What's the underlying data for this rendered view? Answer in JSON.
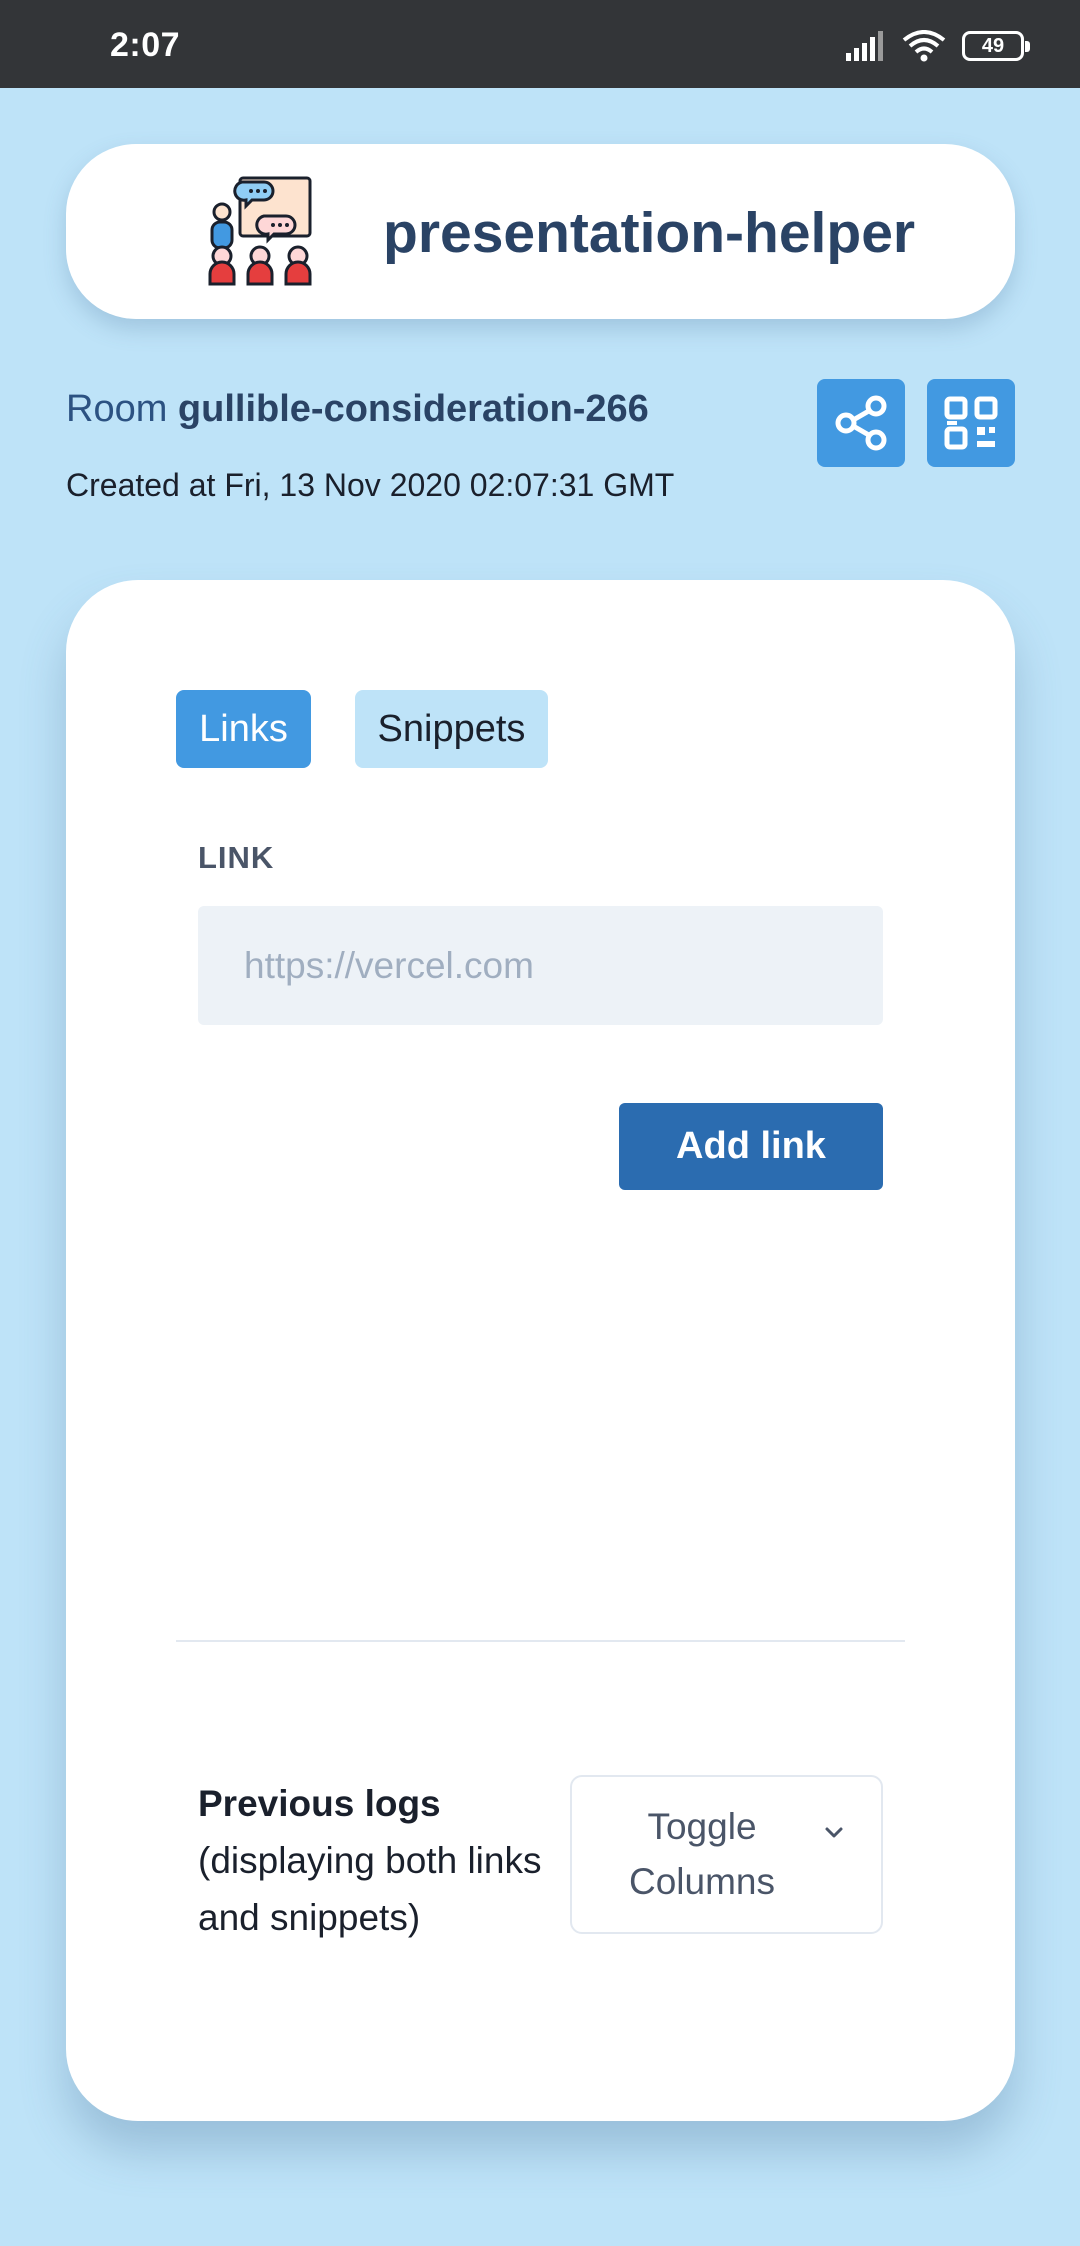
{
  "status_bar": {
    "time": "2:07",
    "battery": "49",
    "icons": [
      "signal-icon",
      "wifi-icon",
      "battery-icon"
    ]
  },
  "header": {
    "title": "presentation-helper",
    "logo_icon": "presentation-logo-icon"
  },
  "room": {
    "prefix": "Room ",
    "name": "gullible-consideration-266",
    "created": "Created at Fri, 13 Nov 2020 02:07:31 GMT",
    "actions": [
      "share-icon",
      "qr-code-icon"
    ]
  },
  "tabs": [
    {
      "label": "Links",
      "active": true
    },
    {
      "label": "Snippets",
      "active": false
    }
  ],
  "form": {
    "label": "LINK",
    "placeholder": "https://vercel.com",
    "value": "",
    "submit": "Add link"
  },
  "logs": {
    "title": "Previous logs",
    "subtitle": "(displaying both links and snippets)",
    "toggle_label": "Toggle Columns"
  },
  "colors": {
    "background": "#bee3f8",
    "accent": "#4299e1",
    "primary_button": "#2b6cb0",
    "heading": "#2a4365"
  }
}
